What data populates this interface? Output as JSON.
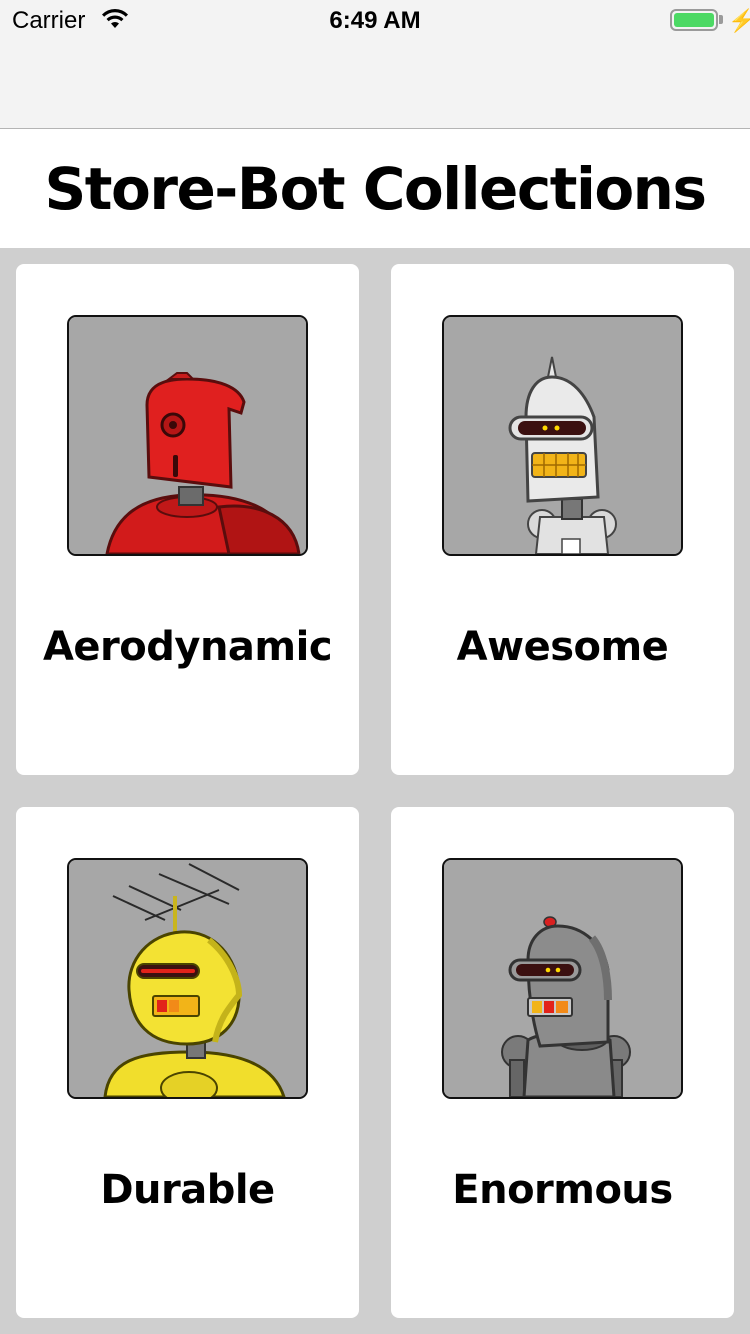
{
  "status_bar": {
    "carrier": "Carrier",
    "time": "6:49 AM"
  },
  "header": {
    "title": "Store-Bot Collections"
  },
  "collections": [
    {
      "label": "Aerodynamic",
      "robot_color": "#e0201f",
      "robot": "red-robot"
    },
    {
      "label": "Awesome",
      "robot_color": "#e6e6e6",
      "robot": "white-robot"
    },
    {
      "label": "Durable",
      "robot_color": "#f3e233",
      "robot": "yellow-robot"
    },
    {
      "label": "Enormous",
      "robot_color": "#8a8a8a",
      "robot": "gray-robot"
    }
  ]
}
